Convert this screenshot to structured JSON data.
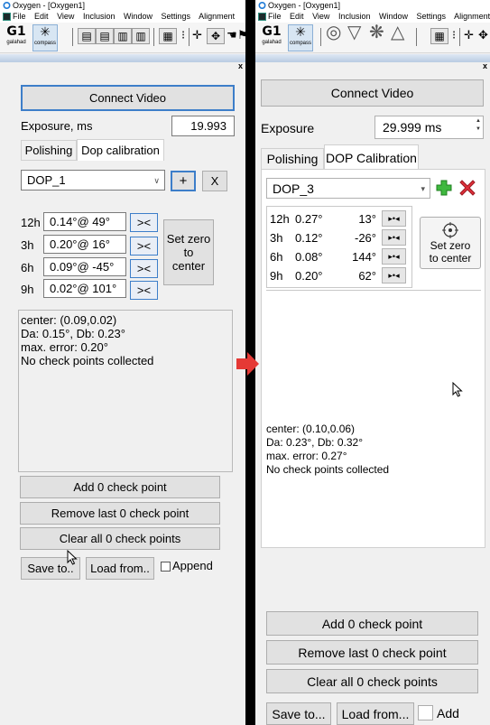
{
  "left": {
    "window_title": "Oxygen - [Oxygen1]",
    "menu": [
      "File",
      "Edit",
      "View",
      "Inclusion",
      "Window",
      "Settings",
      "Alignment"
    ],
    "toolbar": {
      "logo1": {
        "big": "G1",
        "small": "galahad"
      },
      "logo2": {
        "small": "compass"
      }
    },
    "close_label": "x",
    "connect_video": "Connect Video",
    "exposure_label": "Exposure, ms",
    "exposure_value": "19.993",
    "tabs": [
      "Polishing",
      "Dop calibration"
    ],
    "active_tab": "Dop calibration",
    "dop_select": "DOP_1",
    "add_label": "+",
    "remove_label": "X",
    "rows": [
      {
        "hour": "12h",
        "value": "0.14°@  49°",
        "swap": "><"
      },
      {
        "hour": "3h",
        "value": "0.20°@  16°",
        "swap": "><"
      },
      {
        "hour": "6h",
        "value": "0.09°@ -45°",
        "swap": "><"
      },
      {
        "hour": "9h",
        "value": "0.02°@ 101°",
        "swap": "><"
      }
    ],
    "set_zero": "Set zero\nto\ncenter",
    "info": "center: (0.09,0.02)\nDa: 0.15°, Db: 0.23°\nmax. error: 0.20°\nNo check points collected",
    "add_check": "Add 0 check point",
    "remove_check": "Remove last 0 check point",
    "clear_check": "Clear all 0 check points",
    "save": "Save to..",
    "load": "Load from..",
    "append": "Append"
  },
  "right": {
    "window_title": "Oxygen - [Oxygen1]",
    "menu": [
      "File",
      "Edit",
      "View",
      "Inclusion",
      "Window",
      "Settings",
      "Alignment"
    ],
    "toolbar": {
      "logo1": {
        "big": "G1",
        "small": "galahad"
      },
      "logo2": {
        "small": "compass"
      }
    },
    "close_label": "x",
    "connect_video": "Connect Video",
    "exposure_label": "Exposure",
    "exposure_value": "29.999 ms",
    "tabs": [
      "Polishing",
      "DOP Calibration"
    ],
    "active_tab": "DOP Calibration",
    "dop_select": "DOP_3",
    "rows": [
      {
        "hour": "12h",
        "value": "0.27°",
        "angle": "13°"
      },
      {
        "hour": "3h",
        "value": "0.12°",
        "angle": "-26°"
      },
      {
        "hour": "6h",
        "value": "0.08°",
        "angle": "144°"
      },
      {
        "hour": "9h",
        "value": "0.20°",
        "angle": "62°"
      }
    ],
    "set_zero": "Set zero\nto center",
    "info": "center: (0.10,0.06)\nDa: 0.23°, Db: 0.32°\nmax. error: 0.27°\nNo check points collected",
    "add_check": "Add 0 check point",
    "remove_check": "Remove last 0 check point",
    "clear_check": "Clear all 0 check points",
    "save": "Save to...",
    "load": "Load from...",
    "append": "Add"
  },
  "colors": {
    "focus_blue": "#3d7ec9",
    "arrow_red": "#e53935",
    "add_green": "#3fb83f",
    "remove_red": "#e0303a"
  },
  "icons": [
    "oxygen-app-icon",
    "red-right-arrow-icon",
    "mouse-pointer-icon",
    "plus-icon",
    "cross-icon",
    "target-icon"
  ]
}
